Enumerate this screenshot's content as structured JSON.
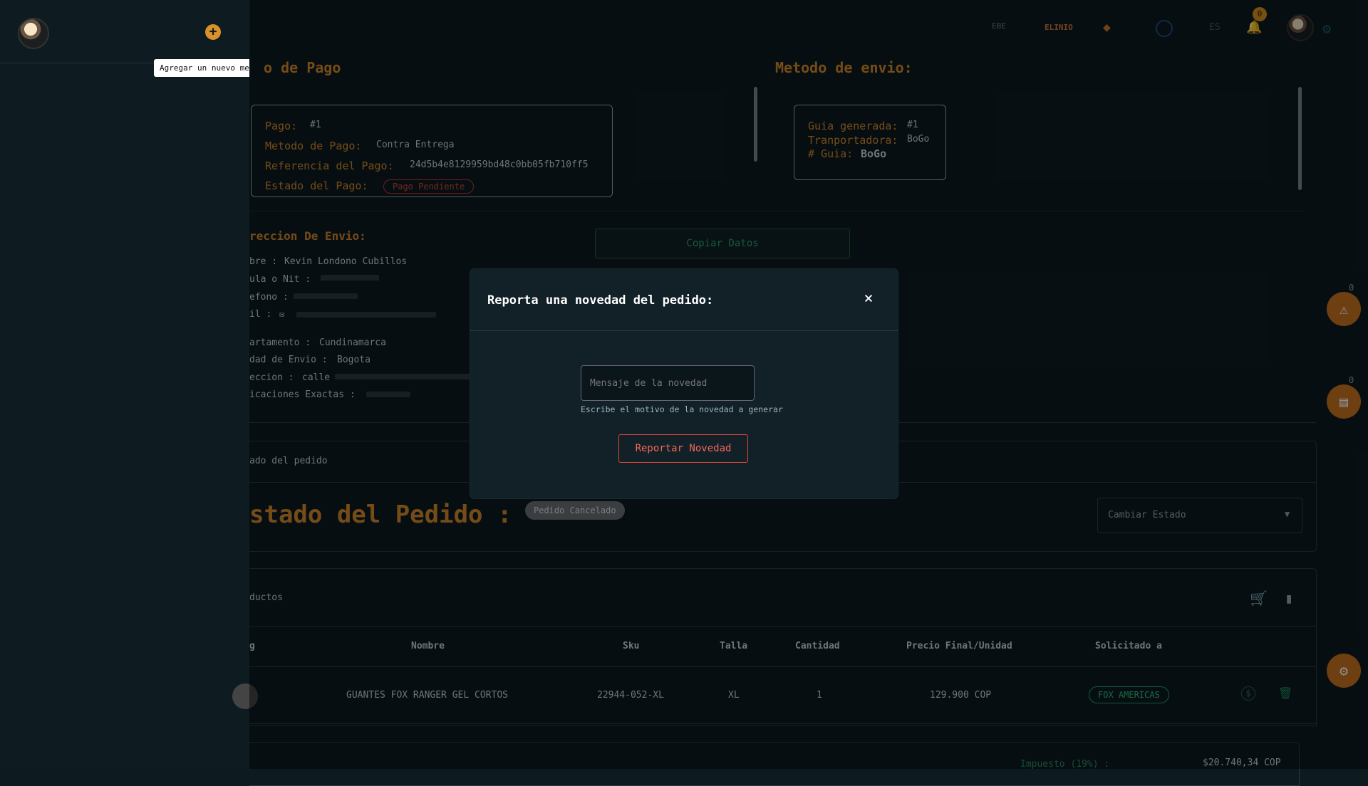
{
  "tooltip": "Agregar un nuevo mensaje",
  "header": {
    "language": "ES",
    "notification_count": "0",
    "brands": [
      "EBE",
      "ELINIO"
    ]
  },
  "payment_section": {
    "title": "Metodo de Pago",
    "title_visible": "o de Pago",
    "pago_label": "Pago:",
    "pago_value": "#1",
    "metodo_label": "Metodo de Pago:",
    "metodo_value": "Contra Entrega",
    "referencia_label": "Referencia del Pago:",
    "referencia_value": "24d5b4e8129959bd48c0bb05fb710ff5",
    "estado_label": "Estado del Pago:",
    "estado_value": "Pago Pendiente"
  },
  "shipping_method": {
    "title": "Metodo de envio:",
    "guia_label": "Guia generada:",
    "guia_value": "#1",
    "transportadora_label": "Tranportadora:",
    "transportadora_value": "BoGo",
    "numero_label": "# Guia:",
    "numero_value": "BoGo"
  },
  "address": {
    "title": "reccion De Envio:",
    "nombre_label": "bre :",
    "nombre_value": "Kevin Londono Cubillos",
    "cedula_label": "ula o Nit :",
    "telefono_label": "efono :",
    "email_label": "il :",
    "departamento_label": "artamento :",
    "departamento_value": "Cundinamarca",
    "ciudad_label": "dad de Envio :",
    "ciudad_value": "Bogota",
    "direccion_label": "eccion :",
    "direccion_value": "calle",
    "indicaciones_label": "icaciones Exactas :"
  },
  "copy_button": "Copiar Datos",
  "order_state": {
    "tab": "ado del pedido",
    "title": "stado del Pedido :",
    "badge": "Pedido Cancelado",
    "select_placeholder": "Cambiar Estado"
  },
  "products": {
    "tab": "ductos",
    "headers": [
      "g",
      "Nombre",
      "Sku",
      "Talla",
      "Cantidad",
      "Precio Final/Unidad",
      "Solicitado a"
    ],
    "rows": [
      {
        "nombre": "GUANTES FOX RANGER GEL CORTOS",
        "sku": "22944-052-XL",
        "talla": "XL",
        "cantidad": "1",
        "precio": "129.900 COP",
        "solicitado": "FOX AMERICAS"
      }
    ]
  },
  "totals": {
    "impuesto_label": "Impuesto (19%) :",
    "impuesto_value": "$20.740,34 COP"
  },
  "side_counts": [
    "0",
    "0"
  ],
  "modal": {
    "title": "Reporta una novedad del pedido:",
    "close": "×",
    "input_placeholder": "Mensaje de la novedad",
    "helper": "Escribe el motivo de la novedad a generar",
    "button": "Reportar Novedad"
  }
}
